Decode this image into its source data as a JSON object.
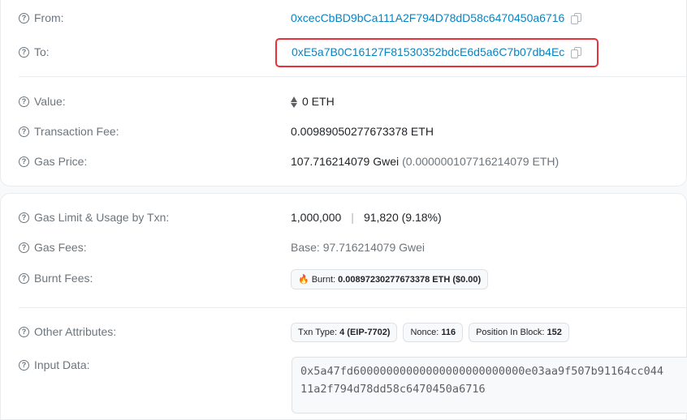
{
  "from": {
    "label": "From:",
    "address": "0xcecCbBD9bCa111A2F794D78dD58c6470450a6716"
  },
  "to": {
    "label": "To:",
    "address": "0xE5a7B0C16127F81530352bdcE6d5a6C7b07db4Ec"
  },
  "value": {
    "label": "Value:",
    "amount": "0 ETH"
  },
  "fee": {
    "label": "Transaction Fee:",
    "amount": "0.00989050277673378 ETH"
  },
  "gas_price": {
    "label": "Gas Price:",
    "gwei": "107.716214079 Gwei",
    "eth": "(0.000000107716214079 ETH)"
  },
  "gas_limit": {
    "label": "Gas Limit & Usage by Txn:",
    "limit": "1,000,000",
    "separator": "|",
    "usage": "91,820 (9.18%)"
  },
  "gas_fees": {
    "label": "Gas Fees:",
    "base": "Base: 97.716214079 Gwei"
  },
  "burnt": {
    "label": "Burnt Fees:",
    "key": "Burnt:",
    "value": "0.00897230277673378 ETH ($0.00)"
  },
  "other": {
    "label": "Other Attributes:",
    "badges": [
      {
        "key": "Txn Type:",
        "value": "4 (EIP-7702)"
      },
      {
        "key": "Nonce:",
        "value": "116"
      },
      {
        "key": "Position In Block:",
        "value": "152"
      }
    ]
  },
  "input_data": {
    "label": "Input Data:",
    "line1": "0x5a47fd60000000000000000000000000e03aa9f507b91164cc044",
    "line2": "11a2f794d78dd58c6470450a6716"
  },
  "colors": {
    "link": "#0784c3",
    "highlight": "#e8313b",
    "muted": "#6c757d"
  }
}
